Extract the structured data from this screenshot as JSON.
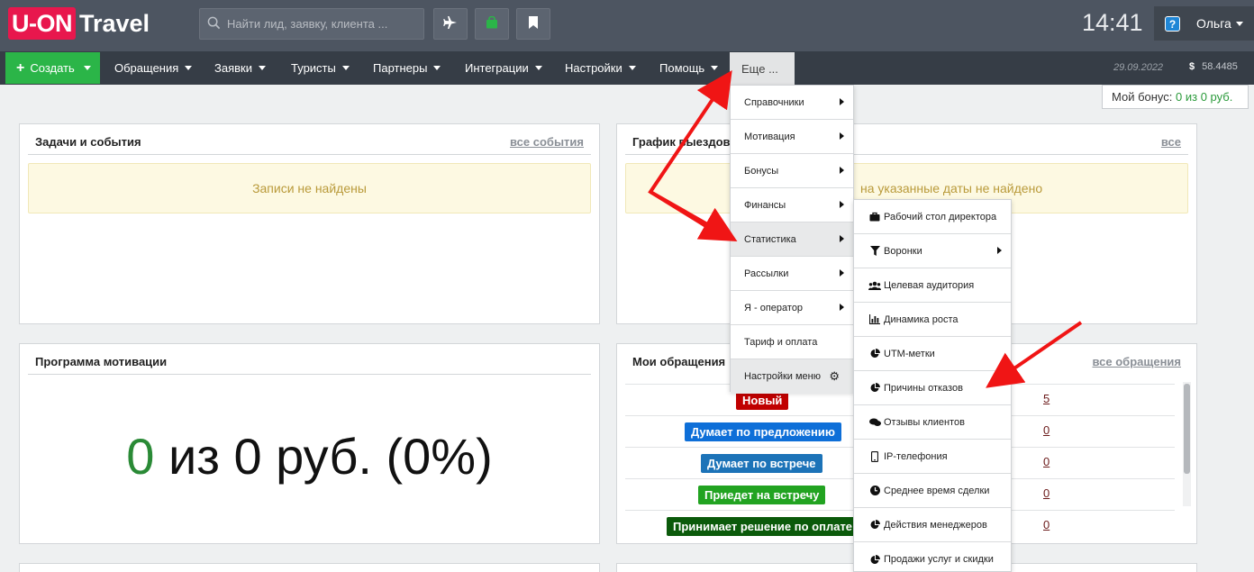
{
  "header": {
    "logo_main": "U-ON",
    "logo_sub": "Travel",
    "search_placeholder": "Найти лид, заявку, клиента ...",
    "clock": "14:41",
    "user_name": "Ольга",
    "help_icon_label": "?"
  },
  "nav": {
    "create_label": "Создать",
    "items": [
      "Обращения",
      "Заявки",
      "Туристы",
      "Партнеры",
      "Интеграции",
      "Настройки",
      "Помощь"
    ],
    "more_label": "Еще ...",
    "date": "29.09.2022",
    "currency_symbol": "$",
    "rate": "58.4485"
  },
  "bonus": {
    "label": "Мой бонус:",
    "value": "0 из 0 руб."
  },
  "panels": {
    "tasks": {
      "title": "Задачи и события",
      "link": "все события",
      "empty": "Записи не найдены"
    },
    "trips": {
      "title": "График выездов",
      "link": "все",
      "empty": "на указанные даты не найдено"
    },
    "motivation": {
      "title": "Программа мотивации",
      "value_highlight": "0",
      "value_rest": " из 0 руб. (0%)"
    },
    "requests": {
      "title": "Мои обращения",
      "link": "все обращения",
      "rows": [
        {
          "status": "Новый",
          "count": "5",
          "color": "#c00000"
        },
        {
          "status": "Думает по предложению",
          "count": "0",
          "color": "#0e6fd8"
        },
        {
          "status": "Думает по встрече",
          "count": "0",
          "color": "#1c73b8"
        },
        {
          "status": "Приедет на встречу",
          "count": "0",
          "color": "#22a321"
        },
        {
          "status": "Принимает решение по оплате",
          "count": "0",
          "color": "#0b5a0b"
        }
      ]
    }
  },
  "menu_more": [
    "Справочники",
    "Мотивация",
    "Бонусы",
    "Финансы",
    "Статистика",
    "Рассылки",
    "Я - оператор",
    "Тариф и оплата",
    "Настройки меню"
  ],
  "menu_statistics": [
    {
      "label": "Рабочий стол директора",
      "icon": "briefcase-icon"
    },
    {
      "label": "Воронки",
      "icon": "filter-icon"
    },
    {
      "label": "Целевая аудитория",
      "icon": "users-icon"
    },
    {
      "label": "Динамика роста",
      "icon": "bar-chart-icon"
    },
    {
      "label": "UTM-метки",
      "icon": "pie-chart-icon"
    },
    {
      "label": "Причины отказов",
      "icon": "pie-chart-icon"
    },
    {
      "label": "Отзывы клиентов",
      "icon": "comments-icon"
    },
    {
      "label": "IP-телефония",
      "icon": "phone-icon"
    },
    {
      "label": "Среднее время сделки",
      "icon": "clock-icon"
    },
    {
      "label": "Действия менеджеров",
      "icon": "pie-chart-icon"
    },
    {
      "label": "Продажи услуг и скидки",
      "icon": "pie-chart-icon"
    }
  ]
}
